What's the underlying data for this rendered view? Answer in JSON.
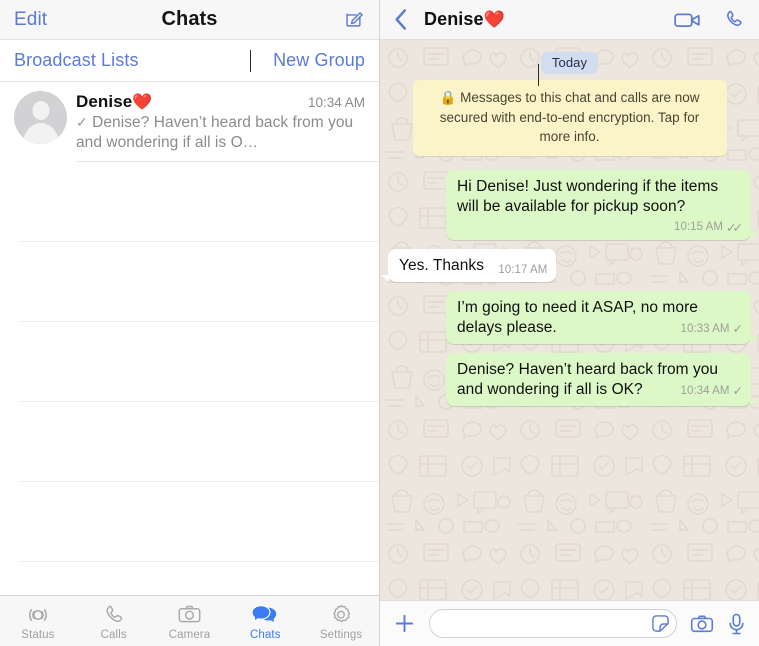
{
  "colors": {
    "ios_blue": "#5b7bd5",
    "active_tab_blue": "#3b7cf6",
    "bubble_out_green": "#dcf8c6",
    "bubble_in_white": "#ffffff",
    "encryption_yellow": "#fbf4c8",
    "day_pill_blue": "#d3ddf0",
    "chat_background": "#ece5dd",
    "heart_red": "#e8384f"
  },
  "left_pane": {
    "header": {
      "edit_label": "Edit",
      "title": "Chats",
      "compose_icon": "compose-icon"
    },
    "toolbar": {
      "broadcast_label": "Broadcast Lists",
      "new_group_label": "New Group"
    },
    "chat_list": [
      {
        "avatar_icon": "default-avatar-icon",
        "name": "Denise",
        "name_emoji": "❤️",
        "time": "10:34 AM",
        "status_check": "✓",
        "preview": "Denise? Haven’t heard back from you and wondering if all is O…"
      }
    ],
    "empty_rows": 6,
    "tabs": [
      {
        "label": "Status",
        "icon": "status-rings-icon",
        "active": false
      },
      {
        "label": "Calls",
        "icon": "phone-icon",
        "active": false
      },
      {
        "label": "Camera",
        "icon": "camera-icon",
        "active": false
      },
      {
        "label": "Chats",
        "icon": "chat-bubbles-icon",
        "active": true
      },
      {
        "label": "Settings",
        "icon": "gear-icon",
        "active": false
      }
    ]
  },
  "right_pane": {
    "header": {
      "back_icon": "back-chevron-icon",
      "contact_name": "Denise",
      "contact_emoji": "❤️",
      "video_call_icon": "video-camera-icon",
      "voice_call_icon": "phone-icon"
    },
    "day_divider": "Today",
    "encryption_notice": {
      "lock_icon": "lock-icon",
      "text": "Messages to this chat and calls are now secured with end-to-end encryption. Tap for more info."
    },
    "messages": [
      {
        "direction": "out",
        "text": "Hi Denise! Just wondering if the items will be available for pickup soon?",
        "time": "10:15 AM",
        "ticks": "✓✓",
        "tick_state": "delivered",
        "meta_inline": false
      },
      {
        "direction": "in",
        "text": "Yes. Thanks",
        "time": "10:17 AM",
        "ticks": "",
        "tick_state": "none",
        "meta_inline": true
      },
      {
        "direction": "out",
        "text": "I’m going to need it ASAP, no more delays please.",
        "time": "10:33 AM",
        "ticks": "✓",
        "tick_state": "sent",
        "meta_inline": false
      },
      {
        "direction": "out",
        "text": "Denise? Haven’t heard back from you and wondering if all is OK?",
        "time": "10:34 AM",
        "ticks": "✓",
        "tick_state": "sent",
        "meta_inline": false
      }
    ],
    "composer": {
      "plus_icon": "plus-icon",
      "input_value": "",
      "input_placeholder": "",
      "sticker_icon": "sticker-icon",
      "camera_icon": "camera-icon",
      "mic_icon": "microphone-icon"
    }
  }
}
